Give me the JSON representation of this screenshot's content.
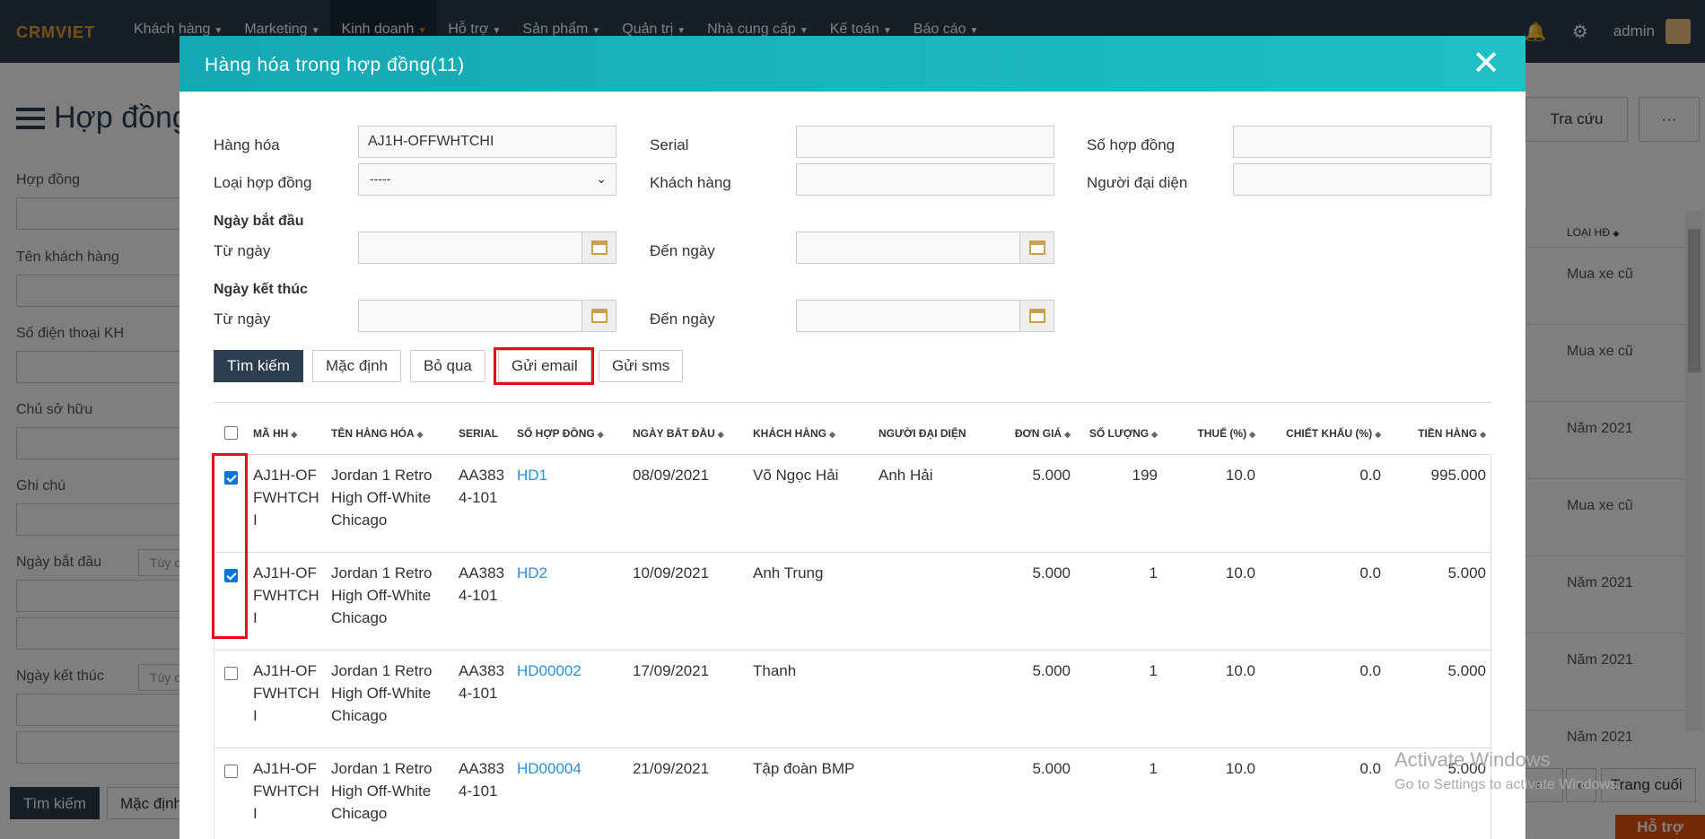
{
  "app": {
    "logo_text": "CRMVIET",
    "menu": [
      {
        "label": "Khách hàng"
      },
      {
        "label": "Marketing"
      },
      {
        "label": "Kinh doanh"
      },
      {
        "label": "Hỗ trợ"
      },
      {
        "label": "Sản phẩm"
      },
      {
        "label": "Quản trị"
      },
      {
        "label": "Nhà cung cấp"
      },
      {
        "label": "Kế toán"
      },
      {
        "label": "Báo cáo"
      }
    ],
    "user": "admin"
  },
  "background": {
    "page_title": "Hợp đồng",
    "filters": [
      "Hợp đồng",
      "Tên khách hàng",
      "Số điện thoại KH",
      "Chủ sở hữu",
      "Ghi chú",
      "Ngày bắt đầu",
      "Ngày kết thúc"
    ],
    "tuy_label": "Tùy c",
    "search_btn": "Tìm kiếm",
    "default_btn": "Mặc định",
    "lookup_btn": "Tra cứu",
    "more_btn": "···",
    "col_header": "LOẠI HĐ",
    "col_values": [
      "Mua xe cũ",
      "Mua xe cũ",
      "Năm 2021",
      "Mua xe cũ",
      "Năm 2021",
      "Năm 2021",
      "Năm 2021"
    ],
    "last_page": "Trang cuối",
    "support_btn": "Hỗ trợ",
    "watermark_title": "Activate Windows",
    "watermark_sub": "Go to Settings to activate Windows."
  },
  "modal": {
    "title": "Hàng hóa trong hợp đồng(11)",
    "close": "✕",
    "fields": {
      "hang_hoa_label": "Hàng hóa",
      "hang_hoa_value": "AJ1H-OFFWHTCHI",
      "serial_label": "Serial",
      "so_hop_dong_label": "Số hợp đồng",
      "loai_hop_dong_label": "Loại hợp đồng",
      "loai_hop_dong_value": "-----",
      "khach_hang_label": "Khách hàng",
      "nguoi_dai_dien_label": "Người đại diện",
      "ngay_bat_dau_label": "Ngày bắt đầu",
      "ngay_ket_thuc_label": "Ngày kết thúc",
      "tu_ngay_label": "Từ ngày",
      "den_ngay_label": "Đến ngày"
    },
    "buttons": {
      "search": "Tìm kiếm",
      "default": "Mặc định",
      "skip": "Bỏ qua",
      "send_email": "Gửi email",
      "send_sms": "Gửi sms"
    },
    "table": {
      "headers": [
        "MÃ HH",
        "TÊN HÀNG HÓA",
        "SERIAL",
        "SỐ HỢP ĐỒNG",
        "NGÀY BẮT ĐẦU",
        "KHÁCH HÀNG",
        "NGƯỜI ĐẠI DIỆN",
        "ĐƠN GIÁ",
        "SỐ LƯỢNG",
        "THUẾ (%)",
        "CHIẾT KHẤU (%)",
        "TIỀN HÀNG"
      ],
      "sort_icon": "◆",
      "rows": [
        {
          "checked": true,
          "ma_hh": "AJ1H-OFFWHTCHI",
          "ten": "Jordan 1 Retro High Off-White Chicago",
          "serial": "AA3834-101",
          "so_hd": "HD1",
          "ngay": "08/09/2021",
          "khach": "Võ Ngọc Hải",
          "dai_dien": "Anh Hải",
          "don_gia": "5.000",
          "so_luong": "199",
          "thue": "10.0",
          "chiet_khau": "0.0",
          "tien": "995.000"
        },
        {
          "checked": true,
          "ma_hh": "AJ1H-OFFWHTCHI",
          "ten": "Jordan 1 Retro High Off-White Chicago",
          "serial": "AA3834-101",
          "so_hd": "HD2",
          "ngay": "10/09/2021",
          "khach": "Anh Trung",
          "dai_dien": "",
          "don_gia": "5.000",
          "so_luong": "1",
          "thue": "10.0",
          "chiet_khau": "0.0",
          "tien": "5.000"
        },
        {
          "checked": false,
          "ma_hh": "AJ1H-OFFWHTCHI",
          "ten": "Jordan 1 Retro High Off-White Chicago",
          "serial": "AA3834-101",
          "so_hd": "HD00002",
          "ngay": "17/09/2021",
          "khach": "Thanh",
          "dai_dien": "",
          "don_gia": "5.000",
          "so_luong": "1",
          "thue": "10.0",
          "chiet_khau": "0.0",
          "tien": "5.000"
        },
        {
          "checked": false,
          "ma_hh": "AJ1H-OFFWHTCHI",
          "ten": "Jordan 1 Retro High Off-White Chicago",
          "serial": "AA3834-101",
          "so_hd": "HD00004",
          "ngay": "21/09/2021",
          "khach": "Tập đoàn BMP",
          "dai_dien": "",
          "don_gia": "5.000",
          "so_luong": "1",
          "thue": "10.0",
          "chiet_khau": "0.0",
          "tien": "5.000"
        }
      ]
    }
  },
  "colors": {
    "nav": "#2c3e50",
    "modal_header": "#14a8b4",
    "highlight": "#e0101a",
    "link": "#2a8fd6",
    "support": "#e8520e"
  }
}
